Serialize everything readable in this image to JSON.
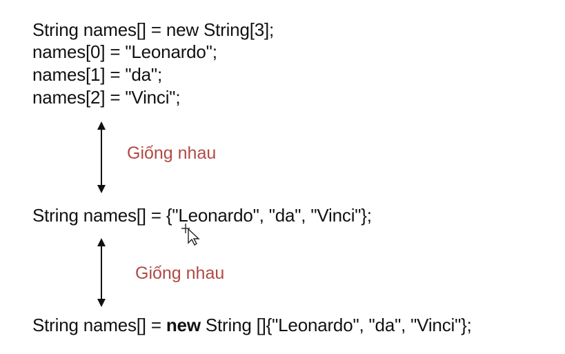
{
  "block1": {
    "lines": [
      "String names[] = new String[3];",
      "names[0] = \"Leonardo\";",
      "names[1] = \"da\";",
      "names[2] = \"Vinci\";"
    ]
  },
  "label1": "Giống nhau",
  "line2": "String names[] = {\"Leonardo\", \"da\", \"Vinci\"};",
  "label2": "Giống nhau",
  "line3": {
    "prefix": "String names[] = ",
    "keyword": "new",
    "suffix": " String []{\"Leonardo\", \"da\", \"Vinci\"};"
  },
  "colors": {
    "text": "#111111",
    "label": "#b04a44",
    "arrow": "#111111"
  },
  "icons": {
    "arrow": "double-headed-vertical-arrow",
    "cursor": "mouse-cursor"
  }
}
